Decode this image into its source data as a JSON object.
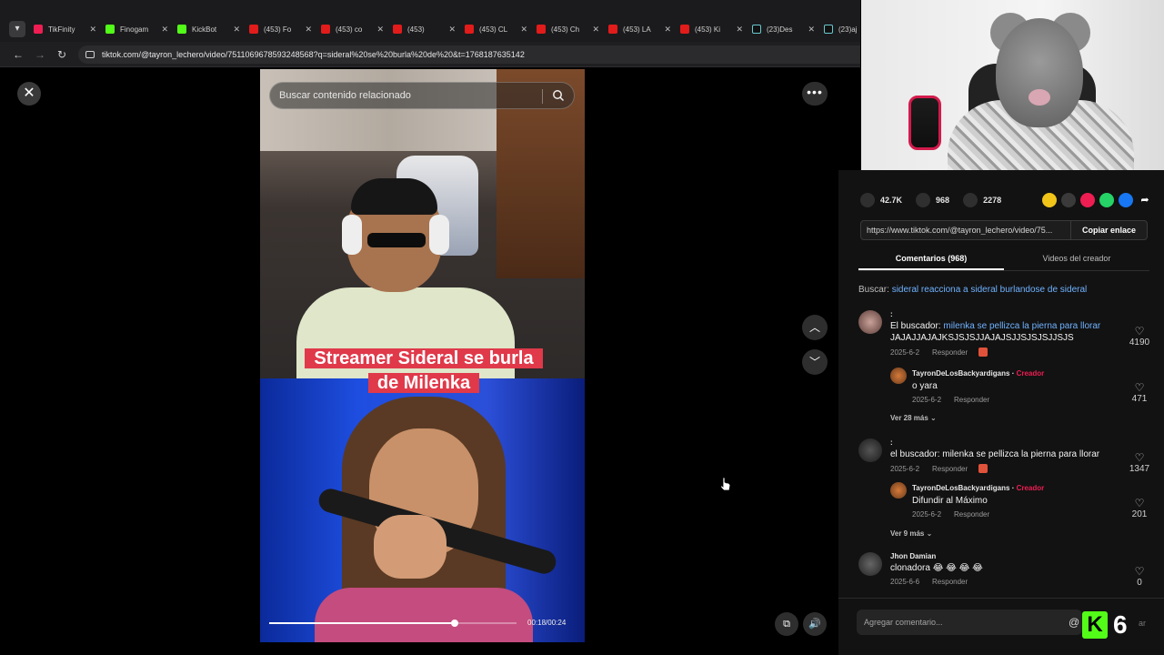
{
  "browser": {
    "tabs": [
      {
        "label": "TikFinity",
        "icon": "tiktok-icon"
      },
      {
        "label": "Finogam",
        "icon": "kick-icon"
      },
      {
        "label": "KickBot",
        "icon": "kick-icon"
      },
      {
        "label": "(453) Fo",
        "icon": "youtube-icon"
      },
      {
        "label": "(453) co",
        "icon": "youtube-icon"
      },
      {
        "label": "(453)",
        "icon": "youtube-icon"
      },
      {
        "label": "(453) CL",
        "icon": "youtube-icon"
      },
      {
        "label": "(453) Ch",
        "icon": "youtube-icon"
      },
      {
        "label": "(453) LA",
        "icon": "youtube-icon"
      },
      {
        "label": "(453) Ki",
        "icon": "youtube-icon"
      },
      {
        "label": "(23)Des",
        "icon": "tiktok-icon"
      },
      {
        "label": "(23)aj",
        "icon": "tiktok-icon"
      }
    ],
    "url": "tiktok.com/@tayron_lechero/video/7511069678593248568?q=sideral%20se%20burla%20de%20&t=1768187635142"
  },
  "video": {
    "search_placeholder": "Buscar contenido relacionado",
    "caption_line1": "Streamer Sideral se burla",
    "caption_line2": "de Milenka",
    "time": "00:18/00:24",
    "progress": 0.75
  },
  "actions": {
    "likes": "42.7K",
    "comments": "968",
    "saves": "2278"
  },
  "share": {
    "url": "https://www.tiktok.com/@tayron_lechero/video/75...",
    "copy_label": "Copiar enlace"
  },
  "tabs": {
    "comments_label": "Comentarios (968)",
    "creator_label": "Videos del creador"
  },
  "search": {
    "prefix": "Buscar:",
    "query": "sideral reacciona a sideral burlandose de sideral"
  },
  "comments": [
    {
      "username": ":",
      "text_prefix": "El buscador:",
      "text_link": "milenka se pellizca la pierna para llorar",
      "text_suffix": "JAJAJJAJAJKSJSJSJJAJAJSJJSJSJSJJSJS",
      "date": "2025-6-2",
      "reply": "Responder",
      "likes": "4190",
      "reply_comment": {
        "username": "TayronDeLosBackyardigans",
        "badge": "Creador",
        "text": "o yara",
        "date": "2025-6-2",
        "reply": "Responder",
        "likes": "471"
      },
      "more": "Ver 28 más"
    },
    {
      "username": ":",
      "text": "el buscador: milenka se pellizca la pierna para llorar",
      "date": "2025-6-2",
      "reply": "Responder",
      "likes": "1347",
      "reply_comment": {
        "username": "TayronDeLosBackyardigans",
        "badge": "Creador",
        "text": "Difundir al Máximo",
        "date": "2025-6-2",
        "reply": "Responder",
        "likes": "201"
      },
      "more": "Ver 9 más"
    },
    {
      "username": "Jhon Damian",
      "text": "clonadora 😂 😂 😂 😂",
      "date": "2025-6-6",
      "reply": "Responder",
      "likes": "0"
    }
  ],
  "add_comment": {
    "placeholder": "Agregar comentario...",
    "post_label": "ar"
  },
  "overlay": {
    "badge_letter": "K",
    "badge_number": "6"
  }
}
